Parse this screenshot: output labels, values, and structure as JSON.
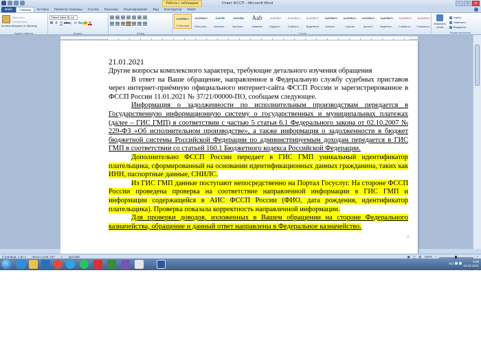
{
  "window": {
    "title": "Ответ ФССП - Microsoft Word",
    "context_tab": "Работа с таблицами",
    "buttons": {
      "minimize": "–",
      "maximize": "□",
      "close": "×"
    }
  },
  "ribbon": {
    "tabs": [
      "Файл",
      "Главная",
      "Вставка",
      "Разметка страницы",
      "Ссылки",
      "Рассылки",
      "Рецензирование",
      "Вид",
      "Конструктор",
      "Макет"
    ],
    "active_tab": "Главная",
    "clipboard": {
      "paste": "Вставить",
      "cut": "Вырезать",
      "copy": "Копировать",
      "format_painter": "Формат по образцу",
      "group_label": "Буфер обмена"
    },
    "font": {
      "name": "Times New Ro",
      "size": "12",
      "group_label": "Шрифт",
      "buttons": [
        "Ж",
        "К",
        "Ч",
        "abc",
        "x₂",
        "x²",
        "Aa",
        "ab",
        "A"
      ]
    },
    "paragraph": {
      "group_label": "Абзац"
    },
    "styles": {
      "group_label": "Стили",
      "items": [
        {
          "sample": "АаБбВвГг",
          "name": "¶ Обычный",
          "selected": true,
          "kind": "normal"
        },
        {
          "sample": "АаБбВвГг",
          "name": "¶ Без инте...",
          "kind": "normal"
        },
        {
          "sample": "АаБбВ",
          "name": "Заголово...",
          "kind": "blue"
        },
        {
          "sample": "АаБбВв",
          "name": "Заголово...",
          "kind": "blue"
        },
        {
          "sample": "Aab",
          "name": "Название",
          "kind": "big"
        },
        {
          "sample": "АаБбВвГ",
          "name": "Подзагол...",
          "kind": "gray"
        },
        {
          "sample": "АаБбВвГг",
          "name": "Слабое в...",
          "kind": "gray"
        },
        {
          "sample": "АаБбВвГг",
          "name": "Выделение",
          "kind": "gray"
        },
        {
          "sample": "АаБбВвГг",
          "name": "Сильное ...",
          "kind": "normal"
        },
        {
          "sample": "АаБбВвГг",
          "name": "Строгий",
          "kind": "normal"
        },
        {
          "sample": "АаБбВвГг",
          "name": "Цитата 2",
          "kind": "normal"
        },
        {
          "sample": "АаБбВвГг",
          "name": "Выделенн...",
          "kind": "normal"
        },
        {
          "sample": "АаБбВвГг",
          "name": "Слабая сс...",
          "kind": "red"
        },
        {
          "sample": "АаБбВвГг",
          "name": "Сильная сс...",
          "kind": "red"
        }
      ],
      "change_styles": "Изменить стили"
    },
    "editing": {
      "group_label": "Редактирование",
      "find": "Найти",
      "replace": "Заменить",
      "select": "Выделить"
    }
  },
  "document": {
    "date": "21.01.2021",
    "subject": "Другие вопросы комплексного характера, требующие детального изучения обращения",
    "paragraphs": [
      "В ответ на Ваше обращение, направленное в Федеральную службу судебных приставов через интернет-приёмную официального интернет-сайта ФССП России и зарегистрированное в ФССП России 11.01.2021 № 37/21/00000-ПО, сообщаем следующее.",
      "Информация о задолженности по исполнительным производствам передается в Государственную информационную систему о государственных и муниципальных платежах (далее – ГИС ГМП) в соответствии с частью 5 статьи 6.1 Федерального закона от 02.10.2007 № 229-ФЗ «Об исполнительном производстве», а также информация о задолженности в бюджет бюджетной системы Российской Федерации по администрируемым доходам передается в ГИС ГМП в соответствии со статьей 160.1 Бюджетного кодекса Российской Федерации.",
      "Дополнительно ФССП России передает в ГИС ГМП уникальный идентификатор плательщика, сформированный на основании идентификационных данных гражданина, таких как ИНН, паспортные данные, СНИЛС.",
      "Из ГИС ГМП данные поступают непосредственно на Портал Госуслуг. На стороне ФССП России проведена проверка на соответствие направленной информации в ГИС ГМП и информации содержащейся в АИС ФССП России (ФИО, дата рождения, идентификатор плательщика). Проверка показала корректность направленной информации.",
      "Для проверки доводов, изложенных в Вашем обращении на стороне Федерального казначейства, обращение и данный ответ направлены в Федеральное казначейство."
    ]
  },
  "statusbar": {
    "page": "Страница: 1 из 1",
    "words": "Число слов: 237",
    "language": "русский",
    "zoom": "100%"
  },
  "taskbar": {
    "language": "RU",
    "time": "9:36",
    "date": "19.02.2021"
  },
  "colors": {
    "highlight": "#ffff00",
    "ribbon_accent": "#2b5797",
    "taskbar": "#3b5f8c"
  }
}
